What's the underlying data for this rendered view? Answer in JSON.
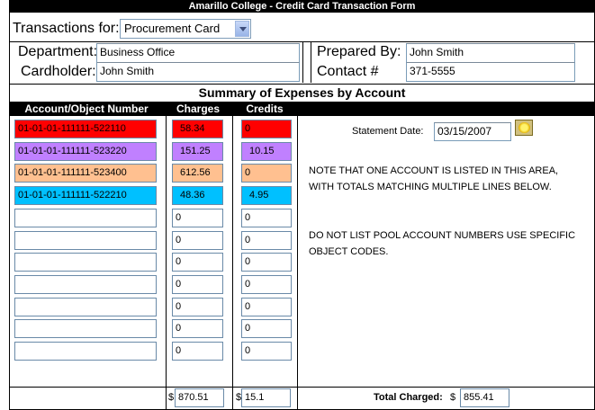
{
  "header": {
    "title": "Amarillo College -  Credit Card Transaction Form"
  },
  "form": {
    "transactions_label": "Transactions for:",
    "transactions_value": "Procurement Card",
    "department_label": "Department:",
    "department_value": "Business Office",
    "cardholder_label": "Cardholder:",
    "cardholder_value": "John Smith",
    "prepared_by_label": "Prepared By:",
    "prepared_by_value": "John Smith",
    "contact_label": "Contact #",
    "contact_value": "371-5555"
  },
  "summary": {
    "title": "Summary of Expenses by Account",
    "columns": {
      "account": "Account/Object Number",
      "charges": "Charges",
      "credits": "Credits"
    },
    "rows": [
      {
        "account": "01-01-01-111111-522110",
        "charges": "58.34",
        "credits": "0",
        "color": "#ff0000"
      },
      {
        "account": "01-01-01-111111-523220",
        "charges": "151.25",
        "credits": "10.15",
        "color": "#c080ff"
      },
      {
        "account": "01-01-01-111111-523400",
        "charges": "612.56",
        "credits": "0",
        "color": "#ffc090"
      },
      {
        "account": "01-01-01-111111-522210",
        "charges": "48.36",
        "credits": "4.95",
        "color": "#00c0ff"
      },
      {
        "account": "",
        "charges": "0",
        "credits": "0",
        "color": "#ffffff"
      },
      {
        "account": "",
        "charges": "0",
        "credits": "0",
        "color": "#ffffff"
      },
      {
        "account": "",
        "charges": "0",
        "credits": "0",
        "color": "#ffffff"
      },
      {
        "account": "",
        "charges": "0",
        "credits": "0",
        "color": "#ffffff"
      },
      {
        "account": "",
        "charges": "0",
        "credits": "0",
        "color": "#ffffff"
      },
      {
        "account": "",
        "charges": "0",
        "credits": "0",
        "color": "#ffffff"
      },
      {
        "account": "",
        "charges": "0",
        "credits": "0",
        "color": "#ffffff"
      }
    ],
    "statement_date_label": "Statement Date:",
    "statement_date_value": "03/15/2007",
    "note1": "NOTE THAT ONE ACCOUNT IS LISTED IN THIS AREA, WITH TOTALS MATCHING MULTIPLE LINES BELOW.",
    "note2": "DO NOT LIST POOL ACCOUNT NUMBERS USE SPECIFIC OBJECT CODES.",
    "charges_total_prefix": "$",
    "charges_total": "870.51",
    "credits_total_prefix": "$",
    "credits_total": "15.1",
    "total_charged_label": "Total Charged:",
    "total_charged_prefix": "$",
    "total_charged_value": "855.41"
  },
  "icons": {
    "calendar": "calendar-icon"
  }
}
